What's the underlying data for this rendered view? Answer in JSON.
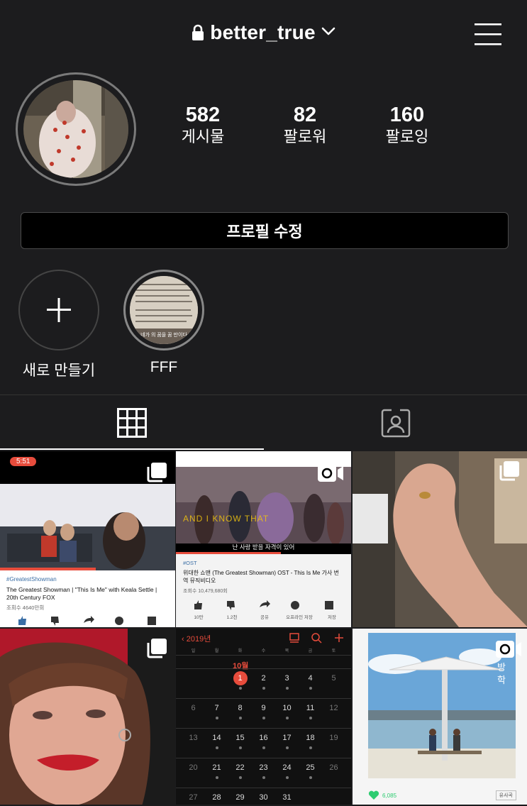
{
  "header": {
    "username": "better_true",
    "menu_icon": "hamburger-icon",
    "lock_icon": "lock-icon"
  },
  "profile": {
    "stats": [
      {
        "value": "582",
        "label": "게시물"
      },
      {
        "value": "82",
        "label": "팔로워"
      },
      {
        "value": "160",
        "label": "팔로잉"
      }
    ],
    "edit_button": "프로필 수정"
  },
  "highlights": [
    {
      "label": "새로 만들기"
    },
    {
      "label": "FFF",
      "cover_text": "네가 의 꿈을 꿈 만이다"
    }
  ],
  "tabs": [
    {
      "icon": "grid-icon",
      "active": true
    },
    {
      "icon": "tagged-person-icon",
      "active": false
    }
  ],
  "posts": {
    "p1": {
      "time": "5:51",
      "hashtag": "#GreatestShowman",
      "title": "The Greatest Showman | \"This Is Me\" with Keala Settle | 20th Century FOX",
      "views": "조회수 4640만회",
      "type": "multi"
    },
    "p2": {
      "overlay_text": "AND I KNOW THAT",
      "subtitle": "난 사랑 받을 자격이 있어",
      "hashtag": "#OST",
      "title": "위대한 쇼맨 (The Greatest Showman) OST - This Is Me 가사 번역 뮤직비디오",
      "views": "조회수 10,479,680회",
      "actions": [
        "10만",
        "1.2천",
        "공유",
        "오프라인 저장",
        "저장"
      ],
      "type": "video"
    },
    "p3": {
      "type": "multi"
    },
    "p4": {
      "type": "multi"
    },
    "p5": {
      "year": "2019년",
      "month": "10월",
      "weekdays": [
        "일",
        "월",
        "화",
        "수",
        "목",
        "금",
        "토"
      ],
      "rows": [
        [
          "",
          "",
          "1",
          "2",
          "3",
          "4",
          "5"
        ],
        [
          "6",
          "7",
          "8",
          "9",
          "10",
          "11",
          "12"
        ],
        [
          "13",
          "14",
          "15",
          "16",
          "17",
          "18",
          "19"
        ],
        [
          "20",
          "21",
          "22",
          "23",
          "24",
          "25",
          "26"
        ],
        [
          "27",
          "28",
          "29",
          "30",
          "31",
          "",
          ""
        ]
      ]
    },
    "p6": {
      "side_text": "방학",
      "likes": "6,085",
      "tag": "유사곡",
      "type": "video"
    }
  },
  "colors": {
    "background": "#1c1c1e",
    "red": "#e74c3c"
  }
}
